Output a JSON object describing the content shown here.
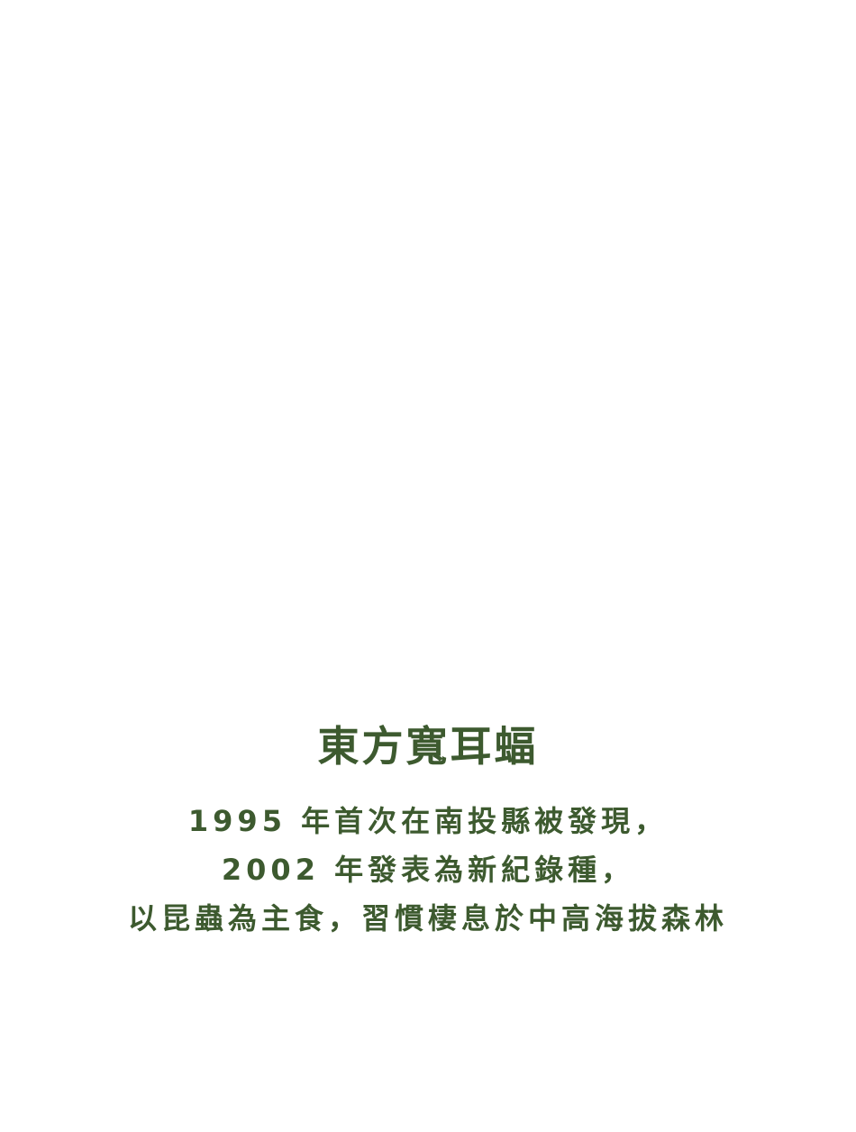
{
  "card": {
    "title": "東方寬耳蝠",
    "lines": [
      "1995 年首次在南投縣被發現，",
      "2002 年發表為新紀錄種，",
      "以昆蟲為主食，習慣棲息於中高海拔森林"
    ],
    "text_color": "#3d5a2f",
    "background_color": "#ffffff"
  }
}
